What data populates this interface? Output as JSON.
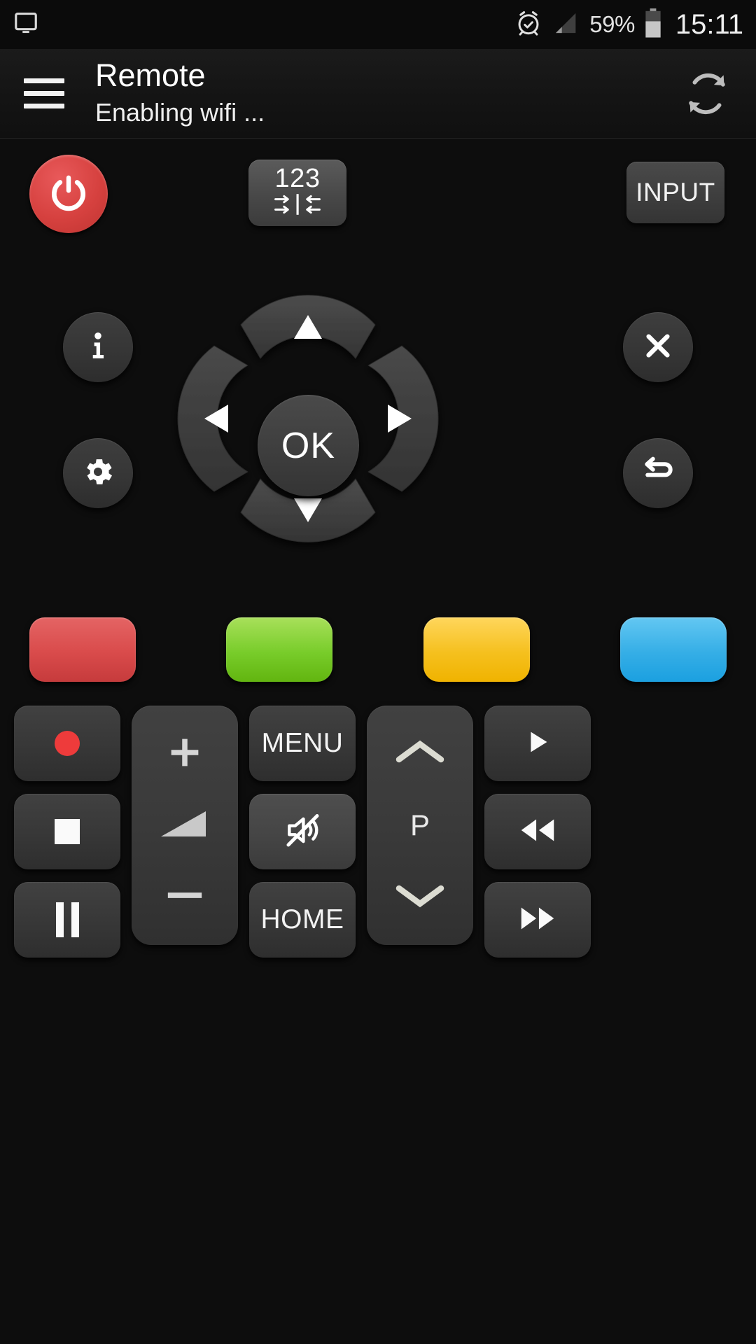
{
  "statusbar": {
    "cast_icon": "monitor-icon",
    "alarm_icon": "alarm-clock-icon",
    "signal_icon": "signal-bars-icon",
    "battery_percent": "59%",
    "battery_icon": "battery-icon",
    "clock": "15:11"
  },
  "actionbar": {
    "menu_icon": "hamburger-menu-icon",
    "title": "Remote",
    "subtitle": "Enabling wifi ...",
    "refresh_icon": "refresh-icon"
  },
  "remote": {
    "power": {
      "name": "power-button",
      "icon": "power-icon",
      "color": "#d6413f"
    },
    "keypad": {
      "name": "numeric-keypad-button",
      "label": "123",
      "icon": "collapse-arrows-icon"
    },
    "input": {
      "name": "input-button",
      "label": "INPUT"
    },
    "info": {
      "name": "info-button",
      "label": "i",
      "icon": "info-icon"
    },
    "settings": {
      "name": "settings-button",
      "icon": "gear-icon"
    },
    "exit": {
      "name": "exit-button",
      "icon": "close-x-icon"
    },
    "back": {
      "name": "back-button",
      "icon": "return-arrow-icon"
    },
    "dpad": {
      "up": "up-arrow-icon",
      "down": "down-arrow-icon",
      "left": "left-arrow-icon",
      "right": "right-arrow-icon",
      "ok_label": "OK"
    },
    "color_buttons": [
      {
        "name": "color-button-red",
        "color": "#d94b4b",
        "color_light": "#e46464",
        "color_dark": "#c63b3c"
      },
      {
        "name": "color-button-green",
        "color": "#78cc2a",
        "color_light": "#a8e05a",
        "color_dark": "#62b510"
      },
      {
        "name": "color-button-yellow",
        "color": "#f5c01e",
        "color_light": "#ffd65c",
        "color_dark": "#f0b300"
      },
      {
        "name": "color-button-blue",
        "color": "#35aee6",
        "color_light": "#63c7f2",
        "color_dark": "#1ba0e0"
      }
    ],
    "transport": {
      "record": {
        "name": "record-button",
        "icon": "record-dot-icon"
      },
      "stop": {
        "name": "stop-button",
        "icon": "stop-square-icon"
      },
      "pause": {
        "name": "pause-button",
        "icon": "pause-bars-icon"
      },
      "play": {
        "name": "play-button",
        "icon": "play-triangle-icon"
      },
      "rewind": {
        "name": "rewind-button",
        "icon": "rewind-icon"
      },
      "forward": {
        "name": "fast-forward-button",
        "icon": "fast-forward-icon"
      }
    },
    "volume": {
      "name": "volume-control",
      "up": {
        "name": "volume-up-button",
        "icon": "plus-icon"
      },
      "level": {
        "name": "volume-level-indicator",
        "icon": "volume-wedge-icon"
      },
      "down": {
        "name": "volume-down-button",
        "icon": "minus-icon"
      }
    },
    "program": {
      "name": "program-control",
      "up": {
        "name": "program-up-button",
        "icon": "chevron-up-icon"
      },
      "label": "P",
      "down": {
        "name": "program-down-button",
        "icon": "chevron-down-icon"
      }
    },
    "menu": {
      "name": "menu-button",
      "label": "MENU"
    },
    "mute": {
      "name": "mute-button",
      "icon": "mute-speaker-icon"
    },
    "home": {
      "name": "home-button",
      "label": "HOME"
    }
  }
}
